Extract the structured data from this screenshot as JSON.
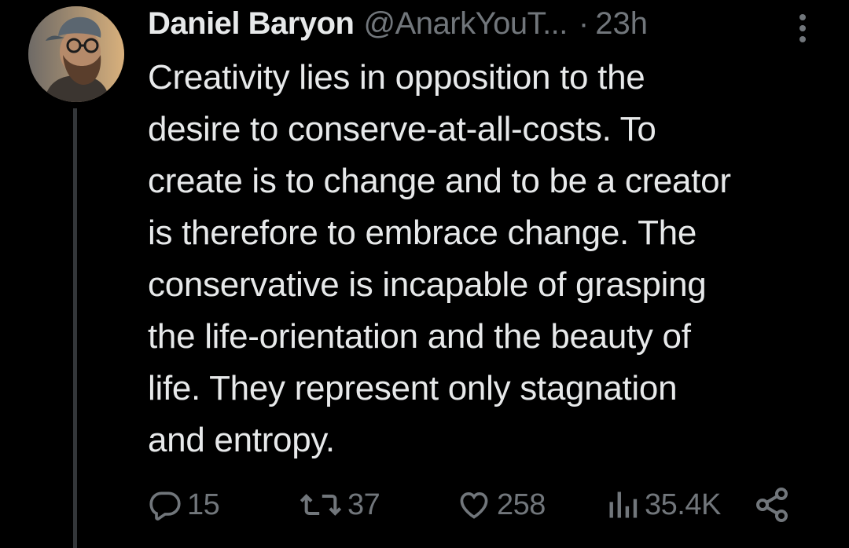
{
  "tweet": {
    "author_name": "Daniel Baryon",
    "author_handle": "@AnarkYouT...",
    "separator": "·",
    "time_ago": "23h",
    "text_lines": [
      "Creativity lies in opposition to the",
      "desire to conserve-at-all-costs. To",
      "create is to change and to be a creator",
      "is therefore to embrace change. The",
      "conservative is incapable of grasping",
      "the life-orientation and the beauty of",
      "life. They represent only stagnation",
      "and entropy."
    ],
    "stats": {
      "replies": "15",
      "reposts": "37",
      "likes": "258",
      "views": "35.4K"
    }
  },
  "icons": {
    "more": "more-vertical-icon",
    "reply": "reply-icon",
    "repost": "repost-icon",
    "like": "heart-icon",
    "views": "views-chart-icon",
    "share": "share-icon"
  },
  "colors": {
    "background": "#000000",
    "primary_text": "#e7e9ea",
    "secondary_text": "#71767b",
    "thread_line": "#333639"
  }
}
